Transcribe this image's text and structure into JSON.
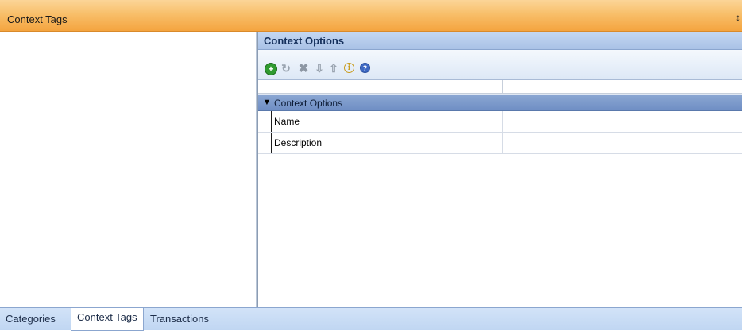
{
  "window": {
    "title": "Context Tags",
    "pin_glyph": "↕"
  },
  "panel": {
    "header": "Context Options",
    "toolbar": [
      {
        "name": "add-icon",
        "glyph": "+"
      },
      {
        "name": "refresh-icon",
        "glyph": "↻"
      },
      {
        "name": "delete-icon",
        "glyph": "✖"
      },
      {
        "name": "move-down-icon",
        "glyph": "⇩"
      },
      {
        "name": "move-up-icon",
        "glyph": "⇧"
      },
      {
        "name": "info-icon",
        "glyph": "i"
      },
      {
        "name": "help-icon",
        "glyph": "?"
      }
    ]
  },
  "grid": {
    "group": {
      "label": "Context Options",
      "toggle_glyph": "▼"
    },
    "rows": [
      {
        "name": "Name",
        "value": ""
      },
      {
        "name": "Description",
        "value": ""
      }
    ]
  },
  "tabs": [
    {
      "label": "Categories",
      "active": false
    },
    {
      "label": "Context Tags",
      "active": true
    },
    {
      "label": "Transactions",
      "active": false
    }
  ]
}
